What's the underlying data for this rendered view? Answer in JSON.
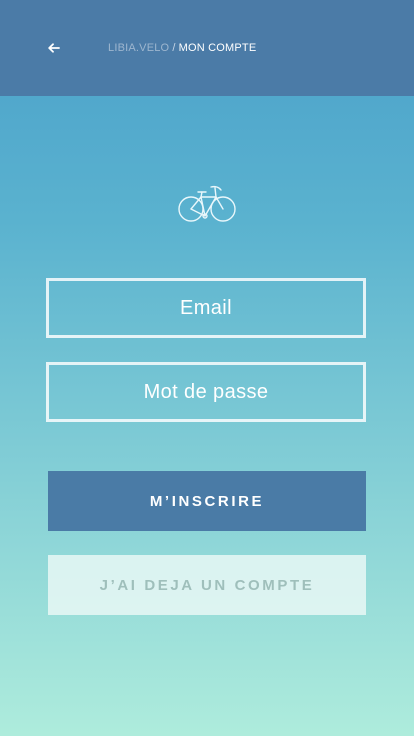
{
  "header": {
    "back_icon": "arrow-left-icon",
    "breadcrumb": {
      "parent": "LIBIA.VELO",
      "separator": "/",
      "current": "MON COMPTE"
    }
  },
  "logo": {
    "icon": "bicycle-icon"
  },
  "form": {
    "email_placeholder": "Email",
    "password_placeholder": "Mot de passe"
  },
  "actions": {
    "signup_label": "M’INSCRIRE",
    "login_label": "J’AI DEJA UN COMPTE"
  },
  "colors": {
    "header_bg": "#4b7ba7",
    "gradient_top": "#4aa0ca",
    "gradient_bottom": "#aeecdc",
    "primary_button": "#4a7ba6",
    "secondary_button_text": "#9fbfbb"
  }
}
